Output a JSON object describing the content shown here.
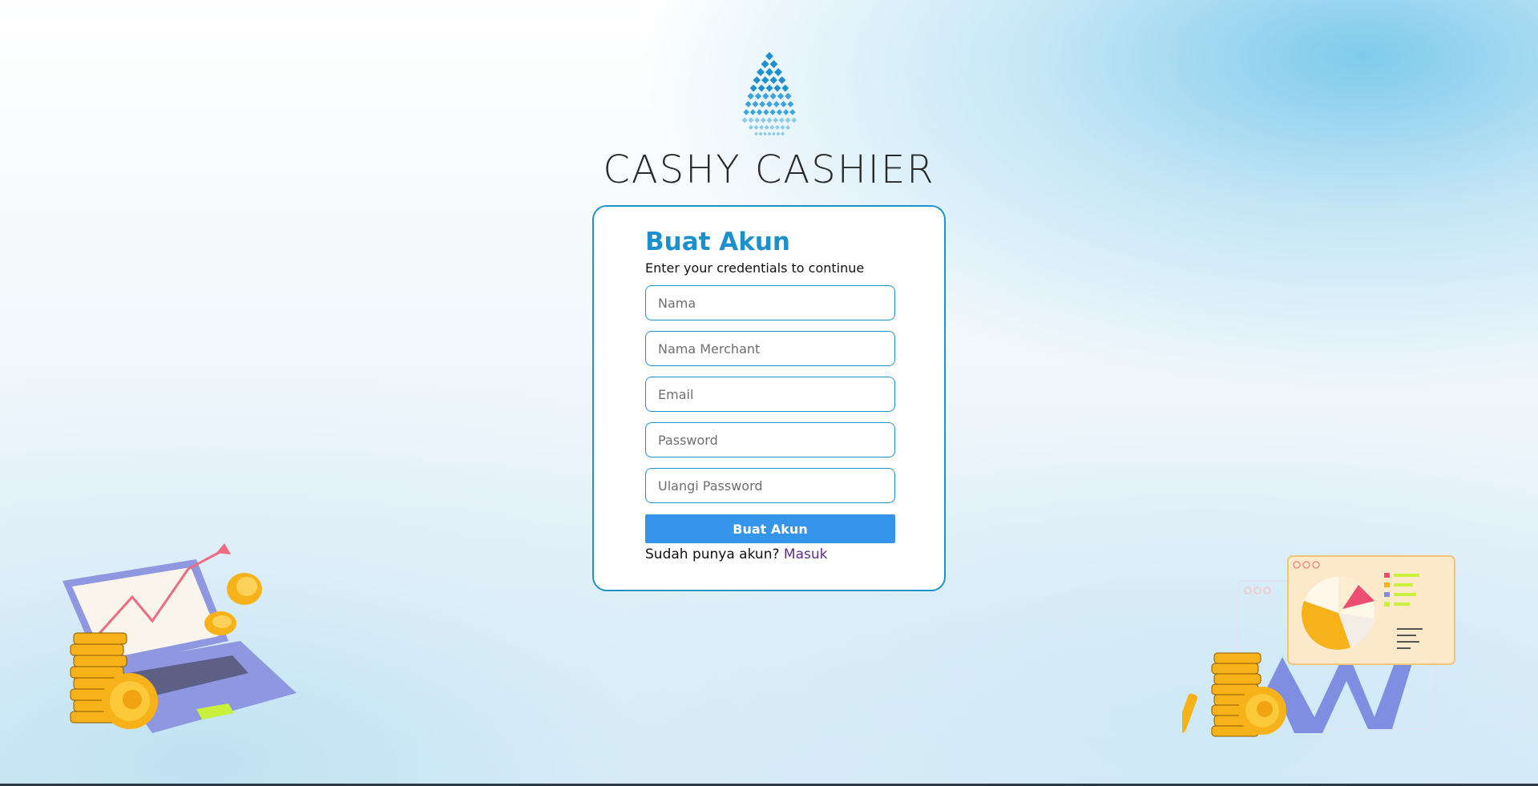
{
  "brand": {
    "name": "CASHY CASHIER"
  },
  "form": {
    "title": "Buat Akun",
    "subtitle": "Enter your credentials to continue",
    "fields": {
      "nama": {
        "placeholder": "Nama",
        "value": ""
      },
      "merchant": {
        "placeholder": "Nama Merchant",
        "value": ""
      },
      "email": {
        "placeholder": "Email",
        "value": ""
      },
      "password": {
        "placeholder": "Password",
        "value": ""
      },
      "confirm_password": {
        "placeholder": "Ulangi Password",
        "value": ""
      }
    },
    "submit_label": "Buat Akun",
    "login_prompt": "Sudah punya akun?",
    "login_link": "Masuk"
  },
  "colors": {
    "accent": "#1d8fcd",
    "button": "#3595ea",
    "link": "#5b2d86",
    "card_border": "#1f93c9"
  },
  "icons": {
    "logo": "diamond-grid-logo-icon",
    "left_illustration": "laptop-coins-growth-illustration",
    "right_illustration": "dashboard-chart-coins-illustration"
  }
}
